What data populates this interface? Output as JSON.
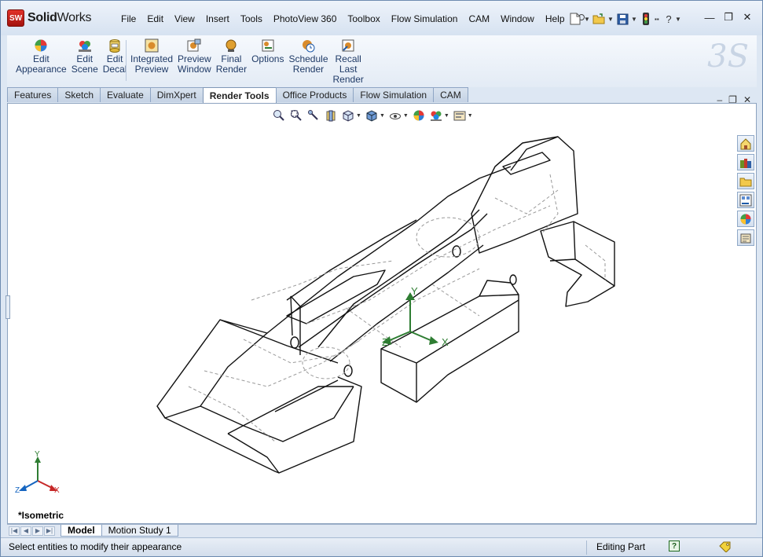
{
  "app": {
    "name_bold": "Solid",
    "name_rest": "Works",
    "badge": "SW"
  },
  "menu": [
    "File",
    "Edit",
    "View",
    "Insert",
    "Tools",
    "PhotoView 360",
    "Toolbox",
    "Flow Simulation",
    "CAM",
    "Window",
    "Help"
  ],
  "ribbon": {
    "buttons": [
      {
        "line1": "Edit",
        "line2": "Appearance",
        "icon": "appearance-ball-icon"
      },
      {
        "line1": "Edit",
        "line2": "Scene",
        "icon": "scene-icon"
      },
      {
        "line1": "Edit",
        "line2": "Decal",
        "icon": "decal-icon"
      },
      {
        "line1": "Integrated",
        "line2": "Preview",
        "icon": "integrated-preview-icon"
      },
      {
        "line1": "Preview",
        "line2": "Window",
        "icon": "preview-window-icon"
      },
      {
        "line1": "Final",
        "line2": "Render",
        "icon": "final-render-icon"
      },
      {
        "line1": "Options",
        "line2": "",
        "icon": "options-icon"
      },
      {
        "line1": "Schedule",
        "line2": "Render",
        "icon": "schedule-render-icon"
      },
      {
        "line1": "Recall",
        "line2": "Last",
        "line3": "Render",
        "icon": "recall-render-icon"
      }
    ]
  },
  "tabs": [
    "Features",
    "Sketch",
    "Evaluate",
    "DimXpert",
    "Render Tools",
    "Office Products",
    "Flow Simulation",
    "CAM"
  ],
  "active_tab": "Render Tools",
  "viewport": {
    "view_label": "*Isometric",
    "triad": {
      "x": "X",
      "y": "Y",
      "z": "Z"
    }
  },
  "bottom_tabs": [
    "Model",
    "Motion Study 1"
  ],
  "status": {
    "message": "Select entities to modify their appearance",
    "mode": "Editing Part",
    "help": "?"
  },
  "colors": {
    "accent": "#1f3a66",
    "triad_x": "#c62828",
    "triad_y": "#2e7d32",
    "triad_z": "#1565c0"
  }
}
